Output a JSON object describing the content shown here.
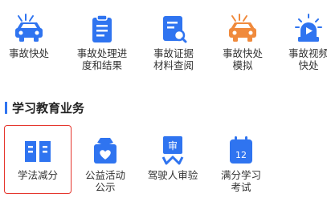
{
  "top_row": [
    {
      "label_lines": [
        "事故快处"
      ],
      "icon": "car-collision-icon"
    },
    {
      "label_lines": [
        "事故处理进",
        "度和结果"
      ],
      "icon": "clipboard-icon"
    },
    {
      "label_lines": [
        "事故证据",
        "材料查阅"
      ],
      "icon": "document-search-icon"
    },
    {
      "label_lines": [
        "事故快处",
        "模拟"
      ],
      "icon": "car-collision-orange-icon"
    },
    {
      "label_lines": [
        "事故视频",
        "快处"
      ],
      "icon": "video-alarm-icon"
    }
  ],
  "section": {
    "title": "学习教育业务"
  },
  "bottom_row": [
    {
      "label_lines": [
        "学法减分"
      ],
      "icon": "open-book-icon"
    },
    {
      "label_lines": [
        "公益活动",
        "公示"
      ],
      "icon": "heart-badge-icon"
    },
    {
      "label_lines": [
        "驾驶人审验"
      ],
      "icon": "review-flag-icon",
      "icon_text": "审"
    },
    {
      "label_lines": [
        "满分学习",
        "考试"
      ],
      "icon": "calendar-12-icon",
      "icon_text": "12"
    }
  ],
  "colors": {
    "blue": "#2f74f0",
    "orange": "#f08a3c",
    "highlight": "#e5342b"
  }
}
